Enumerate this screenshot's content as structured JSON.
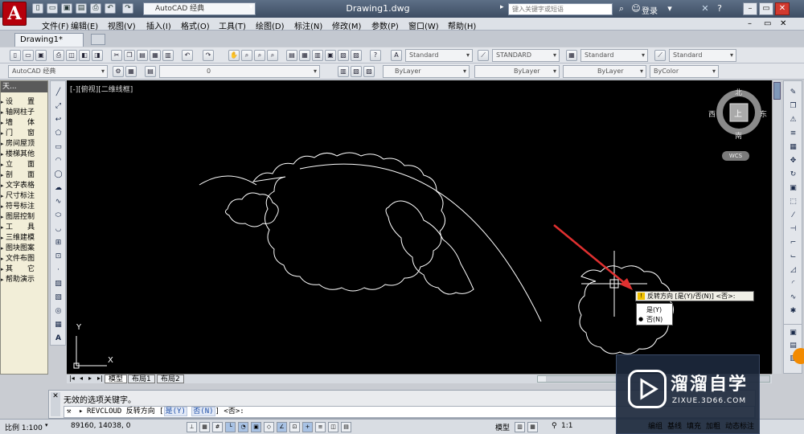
{
  "app": {
    "logo_letter": "A",
    "workspace": "AutoCAD 经典",
    "document_title": "Drawing1.dwg",
    "search_placeholder": "键入关键字或短语",
    "login_label": "登录"
  },
  "menu": [
    "文件(F)",
    "编辑(E)",
    "视图(V)",
    "插入(I)",
    "格式(O)",
    "工具(T)",
    "绘图(D)",
    "标注(N)",
    "修改(M)",
    "参数(P)",
    "窗口(W)",
    "帮助(H)"
  ],
  "doc_tab": "Drawing1*",
  "toolbars": {
    "text_style": "Standard",
    "dim_style": "STANDARD",
    "table_style": "Standard",
    "mleader_style": "Standard",
    "workspace_combo": "AutoCAD 经典",
    "layer_value": "0",
    "color": "ByLayer",
    "linetype": "ByLayer",
    "lineweight": "ByLayer",
    "plotstyle": "ByColor"
  },
  "palette": {
    "header": "天...",
    "items": [
      "设　　置",
      "轴网柱子",
      "墙　　体",
      "门　　窗",
      "房间屋顶",
      "楼梯其他",
      "立　　面",
      "剖　　面",
      "文字表格",
      "尺寸标注",
      "符号标注",
      "图层控制",
      "工　　具",
      "三维建模",
      "图块图案",
      "文件布图",
      "其　　它",
      "帮助演示"
    ]
  },
  "canvas": {
    "view_label": "[-][俯视][二维线框]",
    "navcube": {
      "north": "北",
      "south": "南",
      "east": "东",
      "west": "西",
      "top": "上"
    },
    "wcs": "WCS",
    "ucs_x": "X",
    "ucs_y": "Y",
    "prompt": "反转方向 [是(Y)/否(N)] <否>:",
    "options": [
      "是(Y)",
      "否(N)"
    ]
  },
  "layout_tabs": [
    "模型",
    "布局1",
    "布局2"
  ],
  "command": {
    "history": "无效的选项关键字。",
    "current_prefix": "REVCLOUD 反转方向 [",
    "opt_yes": "是(Y)",
    "opt_no": "否(N)",
    "current_suffix": "] <否>:"
  },
  "status": {
    "scale": "比例 1:100",
    "coords": "89160, 14038, 0",
    "model": "模型",
    "annotation_scale": "1:1",
    "buttons": [
      "编组",
      "基线",
      "填充",
      "加粗",
      "动态标注"
    ]
  },
  "watermark": {
    "title": "溜溜自学",
    "url": "ZIXUE.3D66.COM"
  },
  "colors": {
    "canvas_bg": "#000000",
    "cloud_stroke": "#ffffff",
    "arrow": "#e03030",
    "logo_red": "#b5000b"
  }
}
